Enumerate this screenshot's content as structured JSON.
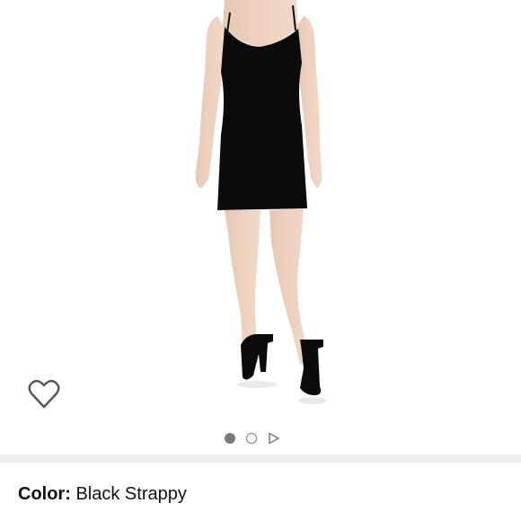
{
  "product": {
    "image_alt": "Black strappy mini slip dress",
    "color_label": "Color:",
    "color_value": "Black Strappy"
  },
  "gallery": {
    "page_count": 2,
    "current_page": 1,
    "has_video": true
  },
  "icons": {
    "wishlist": "heart-outline-icon",
    "video": "play-triangle-icon"
  },
  "colors": {
    "background": "#ffffff",
    "divider": "#eeeeee",
    "indicator": "#7a7a7a",
    "text": "#111111",
    "dress": "#0b0b0b"
  }
}
